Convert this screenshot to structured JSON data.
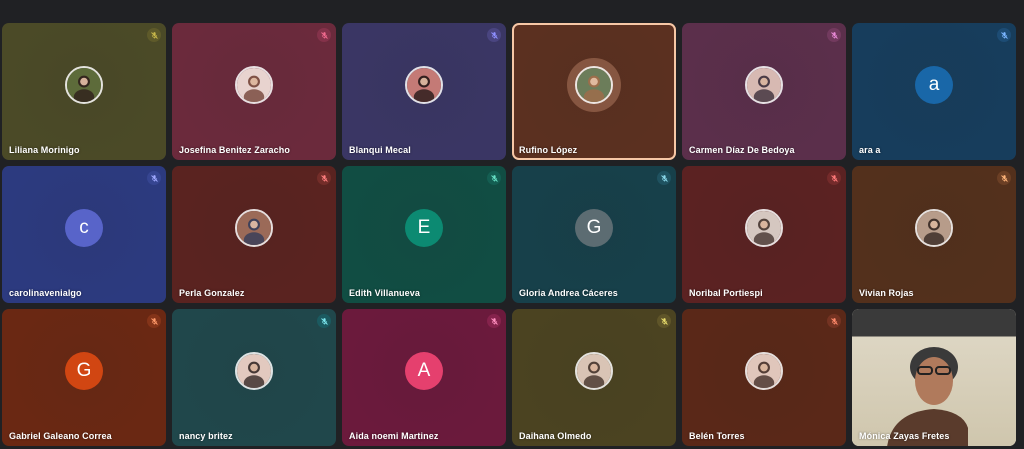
{
  "participants": [
    {
      "name": "Liliana Morinigo",
      "avatar_type": "photo",
      "tile_color": "#4b4a27",
      "photo_tones": [
        "#5d6b3a",
        "#2c1a1a"
      ],
      "mic_color": "#c8b84a",
      "mic_bg": "#5e5a2a"
    },
    {
      "name": "Josefina Benitez Zaracho",
      "avatar_type": "photo",
      "tile_color": "#6b2a3c",
      "photo_tones": [
        "#e8d3cf",
        "#6c3a2e"
      ],
      "mic_color": "#f06a8e",
      "mic_bg": "#84324a"
    },
    {
      "name": "Blanqui Mecal",
      "avatar_type": "photo",
      "tile_color": "#3a3664",
      "photo_tones": [
        "#c47a76",
        "#1b1111"
      ],
      "mic_color": "#8f90ff",
      "mic_bg": "#4a4580"
    },
    {
      "name": "Rufino López",
      "avatar_type": "photo",
      "tile_color": "#5b3020",
      "photo_tones": [
        "#6c7d5a",
        "#a46b49"
      ],
      "mic_color": "",
      "mic_bg": "",
      "speaking": true
    },
    {
      "name": "Carmen Díaz De Bedoya",
      "avatar_type": "photo",
      "tile_color": "#5b2f4b",
      "photo_tones": [
        "#d7b9b2",
        "#312532"
      ],
      "mic_color": "#e889d6",
      "mic_bg": "#723a5e"
    },
    {
      "name": "ara a",
      "avatar_type": "letter",
      "letter": "a",
      "tile_color": "#173d5c",
      "avatar_color": "#1967a8",
      "mic_color": "#7cb7ff",
      "mic_bg": "#1d4c74"
    },
    {
      "name": "carolinavenialgo",
      "avatar_type": "letter",
      "letter": "c",
      "tile_color": "#2c3a7f",
      "avatar_color": "#5864c9",
      "mic_color": "#9fa9ff",
      "mic_bg": "#364591"
    },
    {
      "name": "Perla Gonzalez",
      "avatar_type": "photo",
      "tile_color": "#5a2320",
      "photo_tones": [
        "#9b6a58",
        "#2e3a5a"
      ],
      "mic_color": "#ff7f7f",
      "mic_bg": "#732d29"
    },
    {
      "name": "Edith Villanueva",
      "avatar_type": "letter",
      "letter": "E",
      "tile_color": "#114d43",
      "avatar_color": "#0c8a72",
      "mic_color": "#67e1c6",
      "mic_bg": "#145e52"
    },
    {
      "name": "Gloria Andrea Cáceres",
      "avatar_type": "letter",
      "letter": "G",
      "tile_color": "#17404a",
      "avatar_color": "#5c6c72",
      "mic_color": "#8bd8ea",
      "mic_bg": "#1f5260"
    },
    {
      "name": "Noribal Portiespi",
      "avatar_type": "photo",
      "tile_color": "#5b2222",
      "photo_tones": [
        "#d5c7c0",
        "#3b2a25"
      ],
      "mic_color": "#ff7a7a",
      "mic_bg": "#742b2b"
    },
    {
      "name": "Vivian Rojas",
      "avatar_type": "photo",
      "tile_color": "#53301c",
      "photo_tones": [
        "#b79c8a",
        "#2d201b"
      ],
      "mic_color": "#ffb57a",
      "mic_bg": "#6b3f25"
    },
    {
      "name": "Gabriel Galeano Correa",
      "avatar_type": "letter",
      "letter": "G",
      "tile_color": "#6a2813",
      "avatar_color": "#d14612",
      "mic_color": "#ff9a6a",
      "mic_bg": "#843419"
    },
    {
      "name": "nancy britez",
      "avatar_type": "photo",
      "tile_color": "#20474b",
      "photo_tones": [
        "#e2c9bf",
        "#2a1e1c"
      ],
      "mic_color": "#7de6ee",
      "mic_bg": "#1b5a60"
    },
    {
      "name": "Aida noemi Martinez",
      "avatar_type": "letter",
      "letter": "A",
      "tile_color": "#6b1a3c",
      "avatar_color": "#e5406e",
      "mic_color": "#ff8fbf",
      "mic_bg": "#85234c"
    },
    {
      "name": "Daihana Olmedo",
      "avatar_type": "photo",
      "tile_color": "#4b4321",
      "photo_tones": [
        "#d9c4b5",
        "#3a2a22"
      ],
      "mic_color": "#e6da6a",
      "mic_bg": "#5f5529"
    },
    {
      "name": "Belén Torres",
      "avatar_type": "photo",
      "tile_color": "#5a2818",
      "photo_tones": [
        "#e0c6bb",
        "#3b2620"
      ],
      "mic_color": "#ff8a6b",
      "mic_bg": "#743322"
    },
    {
      "name": "Mónica Zayas Fretes",
      "avatar_type": "video",
      "tile_color": "#e9e2cf",
      "mic_color": "",
      "mic_bg": ""
    }
  ],
  "icons": {
    "muted_mic": "mic-off-icon"
  }
}
